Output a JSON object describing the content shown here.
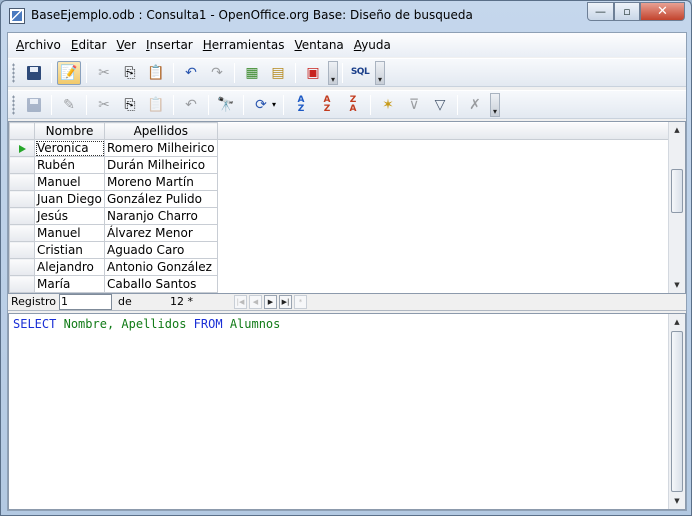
{
  "window": {
    "title": "BaseEjemplo.odb : Consulta1 - OpenOffice.org Base: Diseño de busqueda",
    "minimize_glyph": "—",
    "maximize_glyph": "▫",
    "close_glyph": "✕"
  },
  "menu": [
    {
      "key": "A",
      "rest": "rchivo"
    },
    {
      "key": "E",
      "rest": "ditar"
    },
    {
      "key": "V",
      "rest": "er"
    },
    {
      "key": "I",
      "rest": "nsertar"
    },
    {
      "key": "H",
      "rest": "erramientas"
    },
    {
      "key": "V",
      "rest": "entana",
      "prefix": ""
    },
    {
      "key": "A",
      "rest": "yuda"
    }
  ],
  "toolbar1": {
    "icons": [
      "save-icon",
      "edit-mode-icon",
      "cut-icon",
      "copy-icon",
      "paste-icon",
      "undo-icon",
      "redo-icon",
      "add-tables-icon",
      "design-view-icon",
      "delete-icon",
      "sql-icon"
    ],
    "sql_label": "SQL",
    "more_glyph": "▾"
  },
  "toolbar2": {
    "icons": [
      "save-record-icon",
      "edit-data-icon",
      "cut-icon",
      "copy-icon",
      "paste-icon",
      "undo-icon",
      "find-icon",
      "refresh-icon",
      "sort-ascending-icon",
      "sort-icon",
      "sort-descending-icon",
      "autofilter-icon",
      "standard-filter-icon",
      "apply-filter-icon",
      "remove-filter-icon"
    ],
    "sort_asc_label": "A\nZ",
    "sort_desc_label": "Z\nA",
    "more_glyph": "▾"
  },
  "grid": {
    "columns": [
      "Nombre",
      "Apellidos"
    ],
    "rows": [
      [
        "Veronica",
        "Romero Milheirico"
      ],
      [
        "Rubén",
        "Durán Milheirico"
      ],
      [
        "Manuel",
        "Moreno Martín"
      ],
      [
        "Juan Diego",
        "González Pulido"
      ],
      [
        "Jesús",
        "Naranjo Charro"
      ],
      [
        "Manuel",
        "Álvarez Menor"
      ],
      [
        "Cristian",
        "Aguado Caro"
      ],
      [
        "Alejandro",
        "Antonio González"
      ],
      [
        "María",
        "Caballo Santos"
      ]
    ],
    "current_row": 0
  },
  "navigation": {
    "record_label": "Registro",
    "record_value": "1",
    "of_label": "de",
    "total": "12 *",
    "buttons": [
      "|◀",
      "◀",
      "▶",
      "▶|",
      "*"
    ]
  },
  "sql": {
    "tokens": [
      {
        "t": "SELECT",
        "c": "kw"
      },
      {
        "t": " ",
        "c": ""
      },
      {
        "t": "Nombre,",
        "c": "id"
      },
      {
        "t": " ",
        "c": ""
      },
      {
        "t": "Apellidos",
        "c": "id"
      },
      {
        "t": " ",
        "c": ""
      },
      {
        "t": "FROM",
        "c": "kw"
      },
      {
        "t": " ",
        "c": ""
      },
      {
        "t": "Alumnos",
        "c": "id"
      }
    ]
  },
  "colors": {
    "keyword": "#1a2fd6",
    "identifier": "#117b17",
    "current_row_marker": "#27a72a"
  }
}
